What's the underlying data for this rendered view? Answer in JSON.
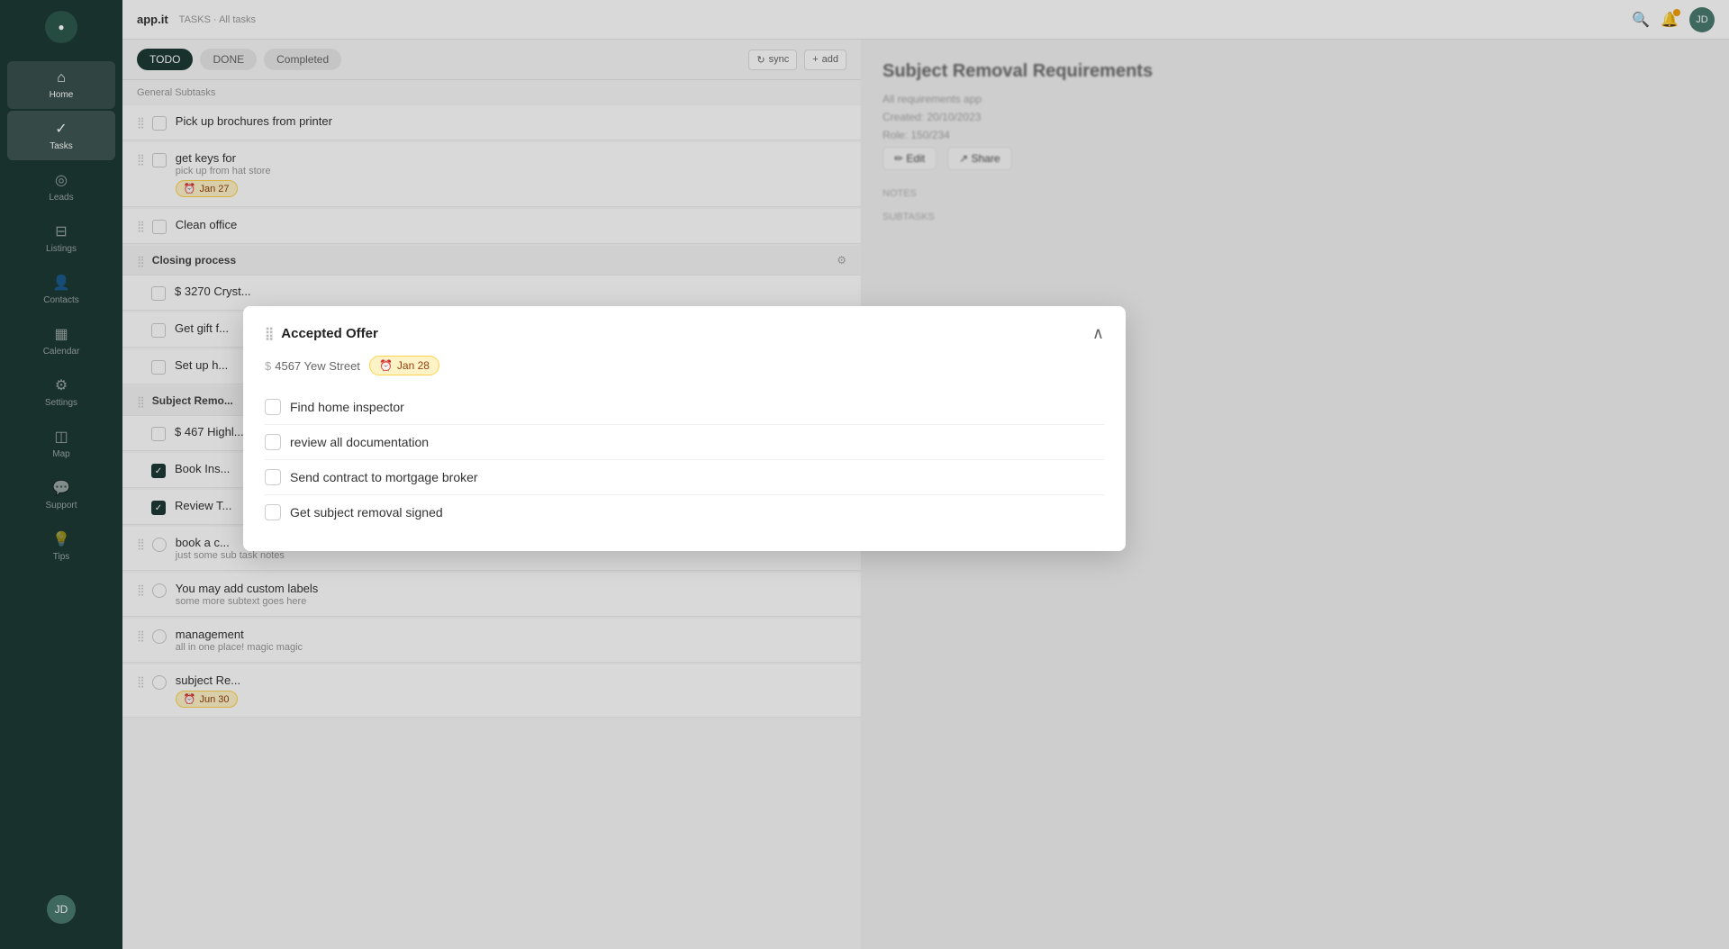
{
  "app": {
    "name": "app.it",
    "breadcrumb": "TASKS · All tasks"
  },
  "sidebar": {
    "items": [
      {
        "id": "home",
        "label": "Home",
        "icon": "⌂",
        "active": false
      },
      {
        "id": "tasks",
        "label": "Tasks",
        "icon": "✓",
        "active": true
      },
      {
        "id": "leads",
        "label": "Leads",
        "icon": "◎",
        "active": false
      },
      {
        "id": "listings",
        "label": "Listings",
        "icon": "⊟",
        "active": false
      },
      {
        "id": "contacts",
        "label": "Contacts",
        "icon": "👤",
        "active": false
      },
      {
        "id": "calendar",
        "label": "Calendar",
        "icon": "📅",
        "active": false
      },
      {
        "id": "settings",
        "label": "Settings",
        "icon": "⚙",
        "active": false
      },
      {
        "id": "map",
        "label": "Map",
        "icon": "🗺",
        "active": false
      },
      {
        "id": "support",
        "label": "Support",
        "icon": "💬",
        "active": false
      },
      {
        "id": "tips",
        "label": "Tips",
        "icon": "💡",
        "active": false
      }
    ]
  },
  "tabs": [
    {
      "id": "todo",
      "label": "TODO",
      "active": true
    },
    {
      "id": "done",
      "label": "DONE",
      "active": false
    },
    {
      "id": "completed",
      "label": "Completed",
      "active": false
    }
  ],
  "tab_actions": [
    {
      "id": "sync",
      "label": "sync"
    },
    {
      "id": "add",
      "label": "add"
    }
  ],
  "group_label": "General Subtasks",
  "tasks": [
    {
      "id": 1,
      "title": "Pick up brochures from printer",
      "subtitle": "",
      "checked": false,
      "badge": null,
      "section": false
    },
    {
      "id": 2,
      "title": "get keys for",
      "subtitle": "pick up from hat store",
      "checked": false,
      "badge": "Jan 27",
      "section": false
    },
    {
      "id": 3,
      "title": "Clean office",
      "subtitle": "",
      "checked": false,
      "badge": null,
      "section": false
    }
  ],
  "sections": [
    {
      "id": "closing",
      "title": "Closing process",
      "subtasks": [
        {
          "id": "c1",
          "title": "$ 3270 Cryst...",
          "subtitle": "",
          "checked": false
        },
        {
          "id": "c2",
          "title": "Get gift f...",
          "subtitle": "",
          "checked": false
        },
        {
          "id": "c3",
          "title": "Set up h...",
          "subtitle": "",
          "checked": false
        }
      ]
    },
    {
      "id": "subject_removal",
      "title": "Subject Remo...",
      "subtasks": [
        {
          "id": "s1",
          "title": "$ 467 Highl...",
          "subtitle": "",
          "checked": false
        },
        {
          "id": "s2",
          "title": "Book Ins...",
          "subtitle": "",
          "checked": true
        },
        {
          "id": "s3",
          "title": "Review T...",
          "subtitle": "",
          "checked": true
        }
      ]
    }
  ],
  "more_tasks": [
    {
      "id": "m1",
      "title": "book a c...",
      "subtitle": "just some sub task notes",
      "checked": false,
      "badge": null
    },
    {
      "id": "m2",
      "title": "You may add custom labels",
      "subtitle": "some more subtext goes here",
      "checked": false,
      "badge": null
    },
    {
      "id": "m3",
      "title": "management",
      "subtitle": "all in one place! magic magic",
      "checked": false,
      "badge": null
    },
    {
      "id": "m4",
      "title": "subject Re...",
      "subtitle": "",
      "checked": false,
      "badge": "Jun 30"
    }
  ],
  "popup": {
    "title": "Accepted Offer",
    "address": "4567 Yew Street",
    "address_prefix": "$",
    "date_badge": "Jan 28",
    "tasks": [
      {
        "id": "p1",
        "label": "Find home inspector",
        "checked": false
      },
      {
        "id": "p2",
        "label": "review all documentation",
        "checked": false
      },
      {
        "id": "p3",
        "label": "Send contract to mortgage broker",
        "checked": false
      },
      {
        "id": "p4",
        "label": "Get subject removal signed",
        "checked": false
      }
    ]
  },
  "right_panel": {
    "title": "Subject Removal Requirements",
    "subtitle1": "All requirements app",
    "created": "Created: 20/10/2023",
    "last_updated": "Role: 150/234",
    "fields": [
      {
        "label": "NOTES",
        "value": ""
      },
      {
        "label": "SUBTASKS",
        "value": ""
      }
    ]
  },
  "topbar": {
    "search_placeholder": "Search...",
    "notification_icon": "🔔",
    "avatar_initials": "JD"
  }
}
